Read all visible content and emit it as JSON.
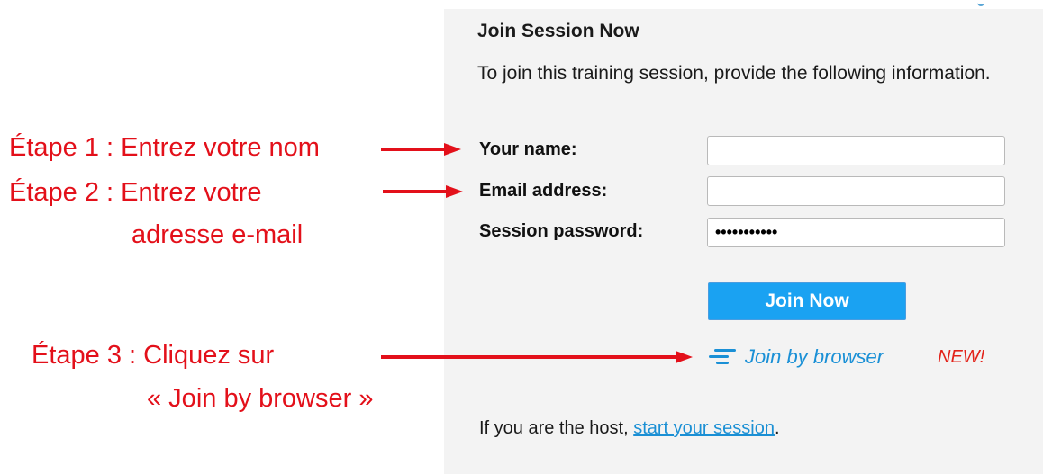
{
  "panel": {
    "title": "Join Session Now",
    "intro": "To join this training session, provide the following information.",
    "fields": {
      "name_label": "Your name:",
      "name_value": "",
      "email_label": "Email address:",
      "email_value": "",
      "password_label": "Session password:",
      "password_value": "•••••••••••"
    },
    "join_button_label": "Join Now",
    "browser_link_label": "Join by browser",
    "new_badge": "NEW!",
    "host_text_prefix": "If you are the host, ",
    "host_link_label": "start your session",
    "host_text_suffix": "."
  },
  "annotations": {
    "step1": "Étape 1 : Entrez votre nom",
    "step2_line1": "Étape 2 : Entrez votre",
    "step2_line2": "adresse e-mail",
    "step3_line1": "Étape 3 : Cliquez sur",
    "step3_line2": "« Join by browser »"
  },
  "colors": {
    "annotation_red": "#e3101a",
    "button_blue": "#1aa2f2",
    "link_blue": "#1a90d6",
    "panel_bg": "#f3f3f3"
  },
  "icons": {
    "browser_link_icon": "stacked-lines-icon"
  }
}
